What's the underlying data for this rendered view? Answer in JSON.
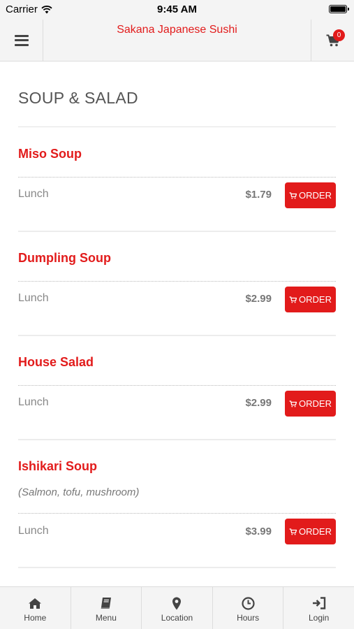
{
  "status_bar": {
    "carrier": "Carrier",
    "time": "9:45 AM",
    "wifi_icon": "wifi-icon",
    "battery_icon": "battery-icon"
  },
  "header": {
    "title": "Sakana Japanese Sushi",
    "menu_icon": "hamburger-icon",
    "cart_icon": "shopping-cart-icon",
    "cart_count": "0"
  },
  "section": {
    "title": "SOUP & SALAD"
  },
  "items": [
    {
      "name": "Miso Soup",
      "description": "",
      "option": "Lunch",
      "price": "$1.79",
      "order_label": "ORDER"
    },
    {
      "name": "Dumpling Soup",
      "description": "",
      "option": "Lunch",
      "price": "$2.99",
      "order_label": "ORDER"
    },
    {
      "name": "House Salad",
      "description": "",
      "option": "Lunch",
      "price": "$2.99",
      "order_label": "ORDER"
    },
    {
      "name": "Ishikari Soup",
      "description": "(Salmon, tofu, mushroom)",
      "option": "Lunch",
      "price": "$3.99",
      "order_label": "ORDER"
    }
  ],
  "bottom_nav": [
    {
      "label": "Home",
      "icon": "home-icon"
    },
    {
      "label": "Menu",
      "icon": "book-icon"
    },
    {
      "label": "Location",
      "icon": "map-marker-icon"
    },
    {
      "label": "Hours",
      "icon": "clock-icon"
    },
    {
      "label": "Login",
      "icon": "login-icon"
    }
  ],
  "colors": {
    "accent": "#e21b1b",
    "header_bg": "#f4f4f4",
    "text": "#555555"
  }
}
